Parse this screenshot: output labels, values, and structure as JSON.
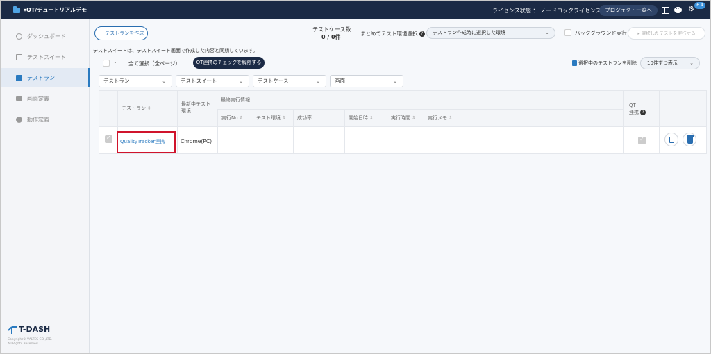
{
  "header": {
    "project_name": "▾QT/チュートリアルデモ",
    "license_status": "ライセンス状態 ： ノードロックライセンス",
    "project_list_button": "プロジェクト一覧へ",
    "version_badge": "6.4",
    "icons": [
      "folder-icon",
      "book-icon",
      "chat-icon",
      "gear-icon"
    ]
  },
  "sidebar": {
    "items": [
      {
        "label": "ダッシュボード",
        "icon": "clock-icon",
        "active": false
      },
      {
        "label": "テストスイート",
        "icon": "suite-icon",
        "active": false
      },
      {
        "label": "テストラン",
        "icon": "run-icon",
        "active": true
      },
      {
        "label": "画面定義",
        "icon": "screen-icon",
        "active": false
      },
      {
        "label": "動作定義",
        "icon": "action-icon",
        "active": false
      }
    ],
    "logo": "T-DASH",
    "copyright_line1": "Copyright© VALTES CO.,LTD.",
    "copyright_line2": "All Rights Reserved."
  },
  "toolbar": {
    "create_button": "＋ テストランを作成",
    "case_count_label": "テストケース数",
    "case_count_value": "0 / 0件",
    "env_select_label": "まとめてテスト環境選択",
    "env_select_value": "テストラン作成時に選択した環境",
    "background_run_label": "バックグラウンド実行",
    "run_selected_button": "選択したテストを実行する"
  },
  "notice": "テストスイートは、テストスイート画面で作成した内容と同期しています。",
  "selection_bar": {
    "select_all": "全て選択（全ページ）",
    "qt_uncheck_button": "QT連携のチェックを解除する",
    "delete_selected": "選択中のテストランを削除",
    "per_page": "10件ずつ表示"
  },
  "filters": [
    "テストラン",
    "テストスイート",
    "テストケース",
    "画面"
  ],
  "table": {
    "headers": {
      "test_run": "テストラン",
      "env_line1": "最新中テスト",
      "env_line2": "環境",
      "last_run_info": "最終実行情報",
      "run_no": "実行No",
      "test_env": "テスト環境",
      "success_rate": "成功率",
      "start_datetime": "開始日時",
      "run_time": "実行時間",
      "run_memo": "実行メモ",
      "qt_line1": "QT",
      "qt_line2": "連携"
    },
    "rows": [
      {
        "test_run": "QualityTracker連携",
        "environment": "Chrome(PC)",
        "run_no": "",
        "test_env": "",
        "success_rate": "",
        "start_datetime": "",
        "run_time": "",
        "run_memo": "",
        "qt_linked": true
      }
    ]
  },
  "colors": {
    "header_bg": "#1b2a45",
    "accent": "#2a7ac0",
    "highlight": "#d0142c"
  }
}
